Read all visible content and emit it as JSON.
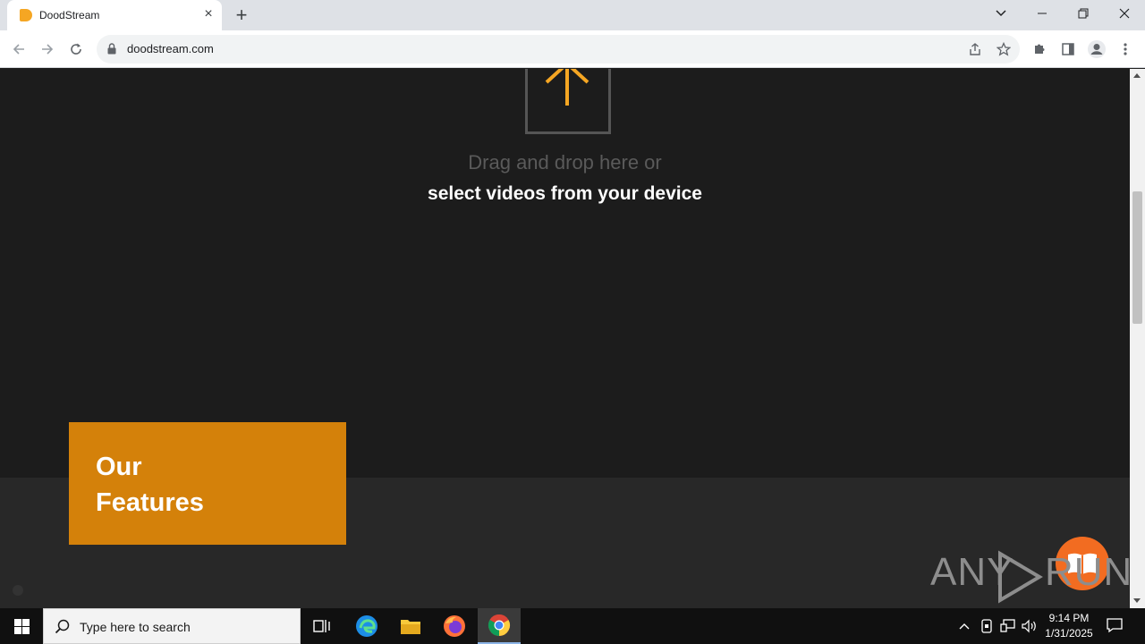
{
  "browser": {
    "tab_title": "DoodStream",
    "tab_close": "×",
    "new_tab": "+",
    "url": "doodstream.com"
  },
  "page": {
    "drag_text": "Drag and drop here or",
    "select_text": "select videos from your device",
    "features_line1": "Our",
    "features_line2": "Features"
  },
  "watermark": {
    "any": "ANY",
    "run": "RUN"
  },
  "taskbar": {
    "search_placeholder": "Type here to search",
    "time": "9:14 PM",
    "date": "1/31/2025"
  },
  "colors": {
    "accent_orange": "#d4810a",
    "upload_arrow": "#f5a623",
    "page_bg": "#1c1c1c"
  }
}
